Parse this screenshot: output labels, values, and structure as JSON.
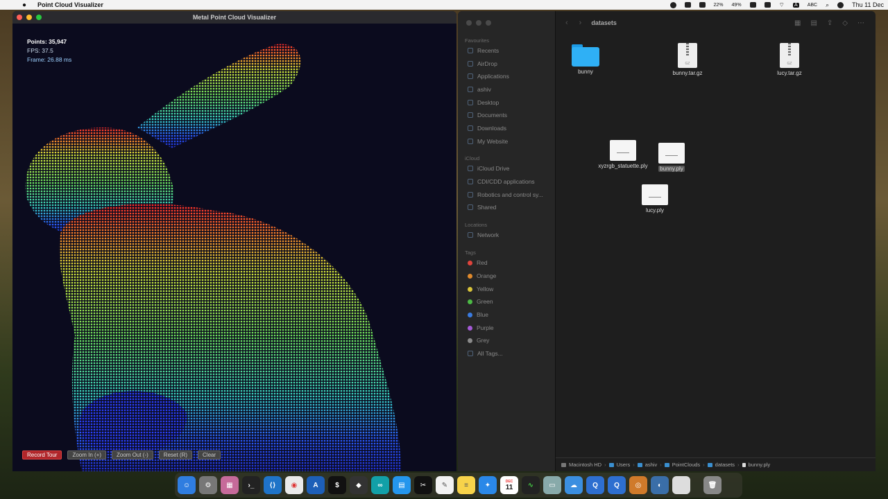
{
  "menubar": {
    "app_name": "Point Cloud Visualizer",
    "battery": "49%",
    "cpu": "22%",
    "input": "ABC",
    "date": "Thu 11 Dec"
  },
  "viz": {
    "window_title": "Metal Point Cloud Visualizer",
    "points": "Points: 35,947",
    "fps": "FPS: 37.5",
    "frame": "Frame: 26.88 ms",
    "buttons": {
      "record": "Record Tour",
      "zoom_in": "Zoom In (+)",
      "zoom_out": "Zoom Out (-)",
      "reset": "Reset (R)",
      "clear": "Clear"
    }
  },
  "finder": {
    "folder": "datasets",
    "sidebar": {
      "favourites_label": "Favourites",
      "favourites": [
        "Recents",
        "AirDrop",
        "Applications",
        "ashiv",
        "Desktop",
        "Documents",
        "Downloads",
        "My Website"
      ],
      "icloud_label": "iCloud",
      "icloud": [
        "iCloud Drive",
        "CDI/CDD applications",
        "Robotics and control sy...",
        "Shared"
      ],
      "locations_label": "Locations",
      "locations": [
        "Network"
      ],
      "tags_label": "Tags",
      "tags": [
        "Red",
        "Orange",
        "Yellow",
        "Green",
        "Blue",
        "Purple",
        "Grey",
        "All Tags..."
      ]
    },
    "tag_colors": [
      "#e0443c",
      "#e08a2c",
      "#d9c43a",
      "#4cba45",
      "#3a7be0",
      "#a45ad6",
      "#8a8a8a"
    ],
    "files": {
      "bunny_folder": "bunny",
      "bunny_tar": "bunny.tar.gz",
      "lucy_tar": "lucy.tar.gz",
      "xyzrgb": "xyzrgb_statuette.ply",
      "bunny_ply": "bunny.ply",
      "lucy_ply": "lucy.ply",
      "gz_ext": "GZ"
    },
    "path": [
      "Macintosh HD",
      "Users",
      "ashiv",
      "PointClouds",
      "datasets",
      "bunny.ply"
    ]
  },
  "dock": {
    "calendar_month": "DEC",
    "calendar_day": "11"
  }
}
